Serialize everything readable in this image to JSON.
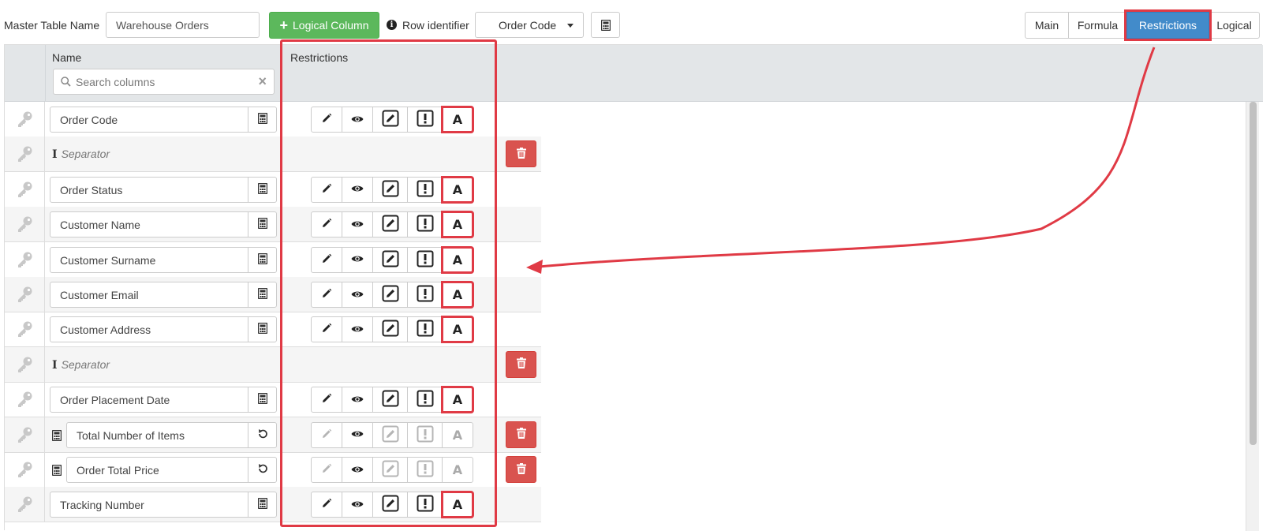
{
  "toolbar": {
    "master_table_label": "Master Table Name",
    "master_table_value": "Warehouse Orders",
    "add_logical_column": "Logical Column",
    "row_identifier_label": "Row identifier",
    "row_identifier_value": "Order Code"
  },
  "view_tabs": {
    "main": "Main",
    "formula": "Formula",
    "restrictions": "Restrictions",
    "logical": "Logical",
    "active": "Restrictions"
  },
  "table": {
    "col_name": "Name",
    "col_restrictions": "Restrictions",
    "search_placeholder": "Search columns",
    "rows": [
      {
        "type": "column",
        "name": "Order Code",
        "restrictions_enabled": true,
        "deletable": false
      },
      {
        "type": "separator",
        "name": "Separator",
        "deletable": true
      },
      {
        "type": "column",
        "name": "Order Status",
        "restrictions_enabled": true,
        "deletable": false
      },
      {
        "type": "column",
        "name": "Customer Name",
        "restrictions_enabled": true,
        "deletable": false
      },
      {
        "type": "column",
        "name": "Customer Surname",
        "restrictions_enabled": true,
        "deletable": false
      },
      {
        "type": "column",
        "name": "Customer Email",
        "restrictions_enabled": true,
        "deletable": false
      },
      {
        "type": "column",
        "name": "Customer Address",
        "restrictions_enabled": true,
        "deletable": false
      },
      {
        "type": "separator",
        "name": "Separator",
        "deletable": true
      },
      {
        "type": "column",
        "name": "Order Placement Date",
        "restrictions_enabled": true,
        "deletable": false
      },
      {
        "type": "calculated",
        "name": "Total Number of Items",
        "restrictions_enabled": false,
        "deletable": true
      },
      {
        "type": "calculated",
        "name": "Order Total Price",
        "restrictions_enabled": false,
        "deletable": true
      },
      {
        "type": "column",
        "name": "Tracking Number",
        "restrictions_enabled": true,
        "deletable": false
      }
    ]
  },
  "colors": {
    "highlight": "#e03a45",
    "active_tab": "#428bca",
    "add_button": "#5cb85c",
    "delete_button": "#d9534f"
  },
  "icons": {
    "row_key": "key-icon",
    "restriction_buttons": [
      "pencil-icon",
      "eye-icon",
      "edit-square-icon",
      "exclamation-square-icon",
      "font-icon"
    ]
  }
}
